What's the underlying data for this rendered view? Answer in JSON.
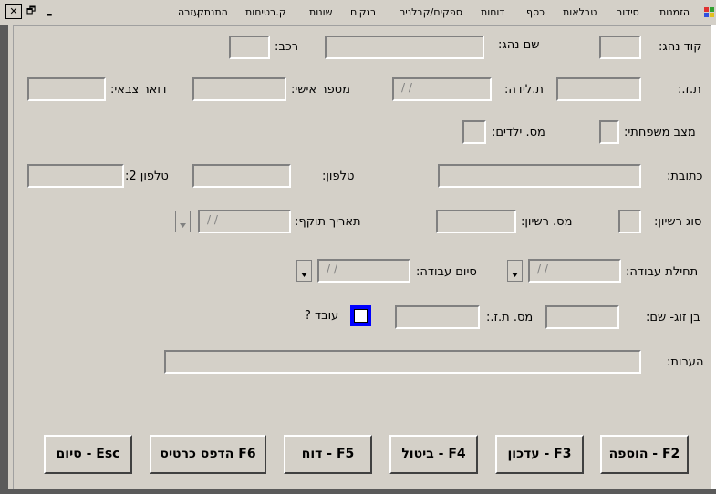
{
  "menu": {
    "items": [
      "הזמנות",
      "סידור",
      "טבלאות",
      "כסף",
      "דוחות",
      "ספקים/קבלנים",
      "בנקים",
      "שונות",
      "ק.בטיחות",
      "התנתק",
      "עזרה"
    ]
  },
  "window": {
    "close": "✕",
    "restore": "🗗",
    "minimize": "‗"
  },
  "form": {
    "driver_code_label": "קוד נהג:",
    "driver_name_label": "שם נהג:",
    "vehicle_label": "רכב:",
    "id_label": "ת.ז.:",
    "birth_label": "ת.לידה:",
    "birth_value": "/ /",
    "personal_num_label": "מספר אישי:",
    "military_mail_label": "דואר צבאי:",
    "marital_label": "מצב משפחתי:",
    "children_label": "מס. ילדים:",
    "address_label": "כתובת:",
    "phone_label": "טלפון:",
    "phone2_label": "טלפון 2:",
    "license_type_label": "סוג רשיון:",
    "license_num_label": "מס. רשיון:",
    "expiry_label": "תאריך תוקף:",
    "expiry_value": "/ /",
    "start_work_label": "תחילת עבודה:",
    "start_work_value": "/ /",
    "end_work_label": "סיום עבודה:",
    "end_work_value": "/ /",
    "spouse_label": "בן זוג- שם:",
    "spouse_id_label": "מס. ת.ז.:",
    "works_label": "עובד ?",
    "notes_label": "הערות:"
  },
  "buttons": {
    "add": "הוספה - F2",
    "update": "עדכון - F3",
    "cancel": "ביטול - F4",
    "report": "דוח - F5",
    "print_card": "הדפס כרטיס F6",
    "finish": "סיום - Esc"
  }
}
